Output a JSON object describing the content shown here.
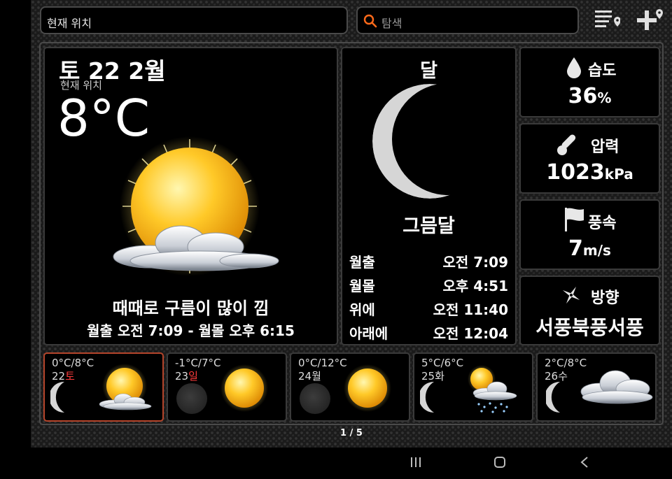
{
  "search_bar": {
    "location_value": "현재 위치",
    "search_placeholder": "탐색"
  },
  "current": {
    "date": "토 22 2월",
    "location": "현재 위치",
    "temperature": "8°C",
    "condition": "때때로 구름이 많이 낌",
    "sun_times": "월출 오전 7:09 - 월몰 오후 6:15",
    "icon": "sun-with-cloud"
  },
  "moon": {
    "title": "달",
    "phase": "그믐달",
    "rows": [
      {
        "label": "월출",
        "value": "오전 7:09"
      },
      {
        "label": "월몰",
        "value": "오후 4:51"
      },
      {
        "label": "위에",
        "value": "오전 11:40"
      },
      {
        "label": "아래에",
        "value": "오전 12:04"
      }
    ]
  },
  "stats": {
    "humidity": {
      "label": "습도",
      "value": "36",
      "unit": "%"
    },
    "pressure": {
      "label": "압력",
      "value": "1023",
      "unit": "kPa"
    },
    "wind_speed": {
      "label": "풍속",
      "value": "7",
      "unit": "m/s"
    },
    "wind_direction": {
      "label": "방향",
      "value": "서풍북풍서풍"
    }
  },
  "forecast": [
    {
      "temp": "0°C/8°C",
      "date": "22",
      "weekday": "토",
      "weekday_red": true,
      "icon": "sun-with-cloud",
      "moon": "crescent",
      "selected": true
    },
    {
      "temp": "-1°C/7°C",
      "date": "23",
      "weekday": "일",
      "weekday_red": true,
      "icon": "sun",
      "moon": "new-moon",
      "selected": false
    },
    {
      "temp": "0°C/12°C",
      "date": "24",
      "weekday": "월",
      "weekday_red": false,
      "icon": "sun",
      "moon": "new-moon",
      "selected": false
    },
    {
      "temp": "5°C/6°C",
      "date": "25",
      "weekday": "화",
      "weekday_red": false,
      "icon": "sun-cloud-snow",
      "moon": "crescent",
      "selected": false
    },
    {
      "temp": "2°C/8°C",
      "date": "26",
      "weekday": "수",
      "weekday_red": false,
      "icon": "cloud",
      "moon": "crescent",
      "selected": false
    }
  ],
  "pager": "1 / 5",
  "colors": {
    "accent_red": "#ff3b3b",
    "selected_border": "#b5452b",
    "search_icon": "#ff6a1a"
  }
}
